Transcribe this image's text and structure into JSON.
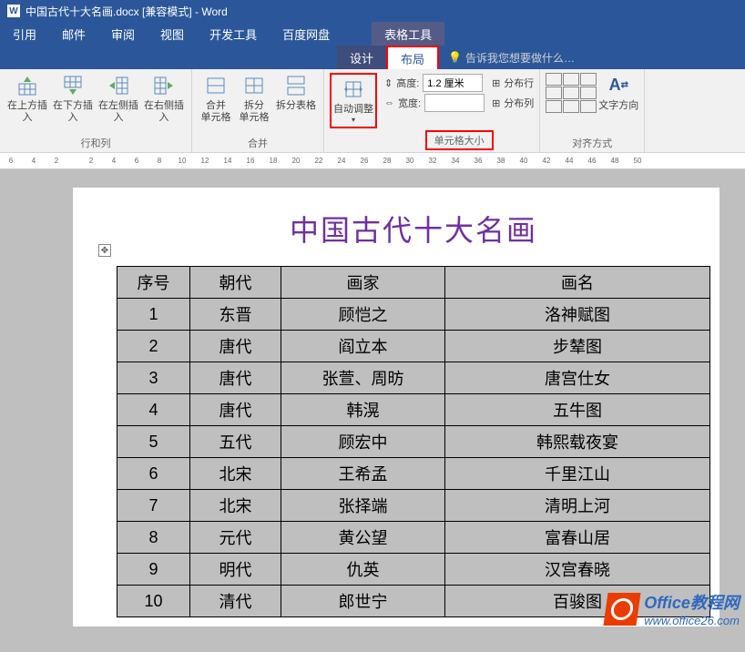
{
  "titlebar": {
    "filename": "中国古代十大名画.docx [兼容模式] - Word"
  },
  "context_tab": "表格工具",
  "tabs": {
    "references": "引用",
    "mailings": "邮件",
    "review": "审阅",
    "view": "视图",
    "developer": "开发工具",
    "baidu": "百度网盘",
    "design": "设计",
    "layout": "布局"
  },
  "tellme": {
    "placeholder": "告诉我您想要做什么…"
  },
  "ribbon": {
    "rows_cols": {
      "insert_above": "在上方插入",
      "insert_below": "在下方插入",
      "insert_left": "在左侧插入",
      "insert_right": "在右侧插入",
      "label": "行和列"
    },
    "merge": {
      "merge_cells": "合并\n单元格",
      "split_cells": "拆分\n单元格",
      "split_table": "拆分表格",
      "label": "合并"
    },
    "autofit": "自动调整",
    "cellsize": {
      "height_label": "高度:",
      "height_value": "1.2 厘米",
      "width_label": "宽度:",
      "dist_rows": "分布行",
      "dist_cols": "分布列",
      "label": "单元格大小"
    },
    "align": {
      "text_dir": "文字方向",
      "label": "对齐方式"
    }
  },
  "ruler_numbers": [
    "6",
    "4",
    "2",
    "2",
    "4",
    "6",
    "8",
    "10",
    "12",
    "14",
    "16",
    "18",
    "20",
    "22",
    "24",
    "26",
    "28",
    "30",
    "32",
    "34",
    "36",
    "38",
    "40",
    "42",
    "44",
    "46",
    "48",
    "50"
  ],
  "document": {
    "title": "中国古代十大名画",
    "headers": [
      "序号",
      "朝代",
      "画家",
      "画名"
    ],
    "rows": [
      [
        "1",
        "东晋",
        "顾恺之",
        "洛神赋图"
      ],
      [
        "2",
        "唐代",
        "阎立本",
        "步辇图"
      ],
      [
        "3",
        "唐代",
        "张萱、周昉",
        "唐宫仕女"
      ],
      [
        "4",
        "唐代",
        "韩滉",
        "五牛图"
      ],
      [
        "5",
        "五代",
        "顾宏中",
        "韩熙载夜宴"
      ],
      [
        "6",
        "北宋",
        "王希孟",
        "千里江山"
      ],
      [
        "7",
        "北宋",
        "张择端",
        "清明上河"
      ],
      [
        "8",
        "元代",
        "黄公望",
        "富春山居"
      ],
      [
        "9",
        "明代",
        "仇英",
        "汉宫春晓"
      ],
      [
        "10",
        "清代",
        "郎世宁",
        "百骏图"
      ]
    ]
  },
  "watermark": {
    "line1": "Office教程网",
    "line2": "www.office26.com"
  }
}
